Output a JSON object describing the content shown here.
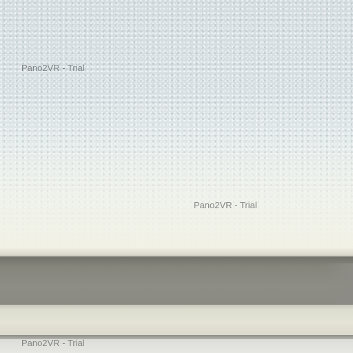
{
  "viewer": {
    "watermarks": [
      {
        "text": "Pano2VR - Trial"
      },
      {
        "text": "Pano2VR - Trial"
      },
      {
        "text": "Pano2VR - Trial"
      }
    ]
  }
}
